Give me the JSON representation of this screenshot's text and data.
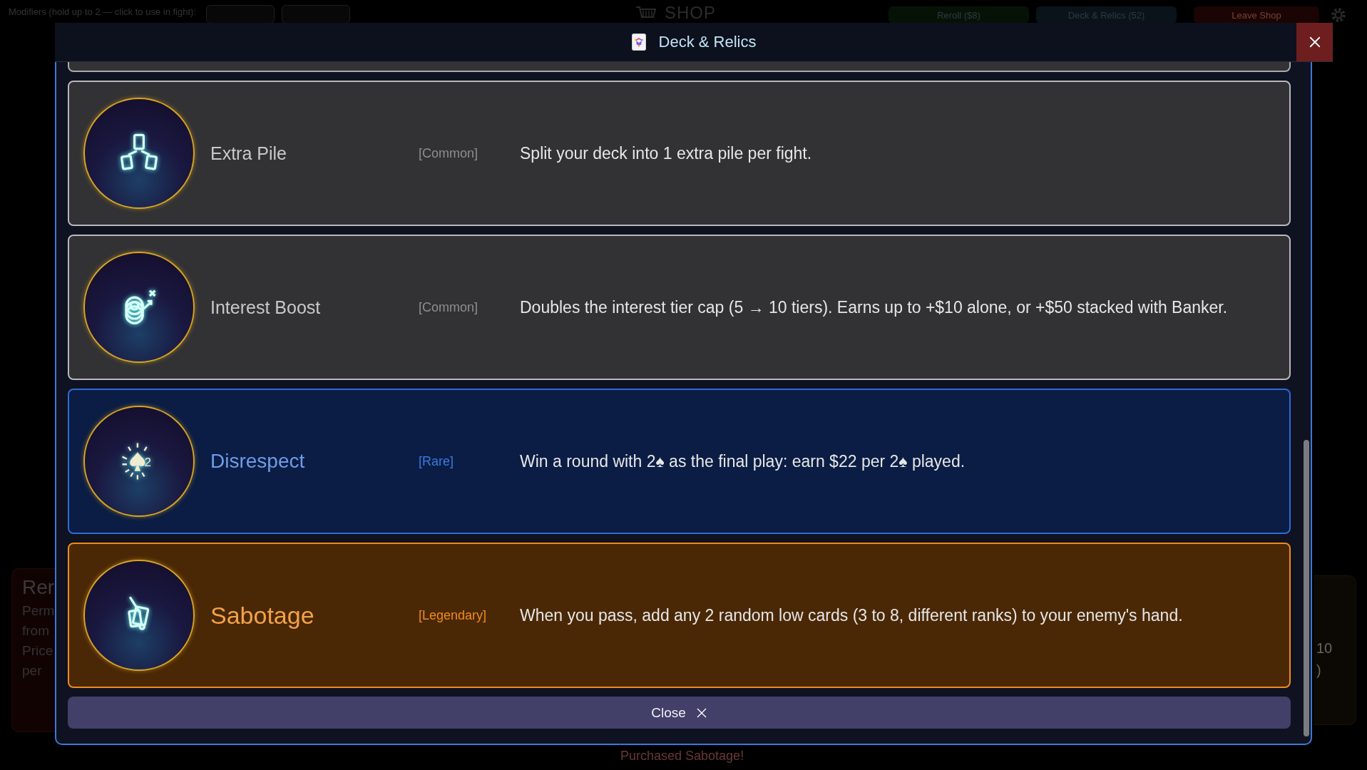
{
  "background": {
    "modifiers_label": "Modifiers (hold up to 2 — click to use in fight):",
    "title": "SHOP",
    "buttons": [
      {
        "label": "Reroll ($8)",
        "kind": "reroll"
      },
      {
        "label": "Deck & Relics (52)",
        "kind": "deck"
      },
      {
        "label": "Leave Shop",
        "kind": "leave"
      }
    ],
    "left_card": {
      "title": "Rer",
      "lines": [
        "Perm",
        "from",
        "Price",
        "per"
      ]
    },
    "right_card": {
      "lines": [
        "10",
        ")"
      ]
    },
    "toast": "Purchased Sabotage!"
  },
  "modal": {
    "title": "Deck & Relics",
    "relics": [
      {
        "name": "Extra Pile",
        "kind": "common",
        "rarity_label": "[Common]",
        "description": "Split your deck into 1 extra pile per fight."
      },
      {
        "name": "Interest Boost",
        "kind": "common",
        "rarity_label": "[Common]",
        "description": "Doubles the interest tier cap (5 → 10 tiers). Earns up to +$10 alone, or +$50 stacked with Banker."
      },
      {
        "name": "Disrespect",
        "kind": "rare",
        "rarity_label": "[Rare]",
        "icon_label": "2",
        "description": "Win a round with 2♠ as the final play: earn $22 per 2♠ played."
      },
      {
        "name": "Sabotage",
        "kind": "legendary",
        "rarity_label": "[Legendary]",
        "description": "When you pass, add any 2 random low cards (3 to 8, different ranks) to your enemy's hand."
      }
    ],
    "close_label": "Close"
  }
}
